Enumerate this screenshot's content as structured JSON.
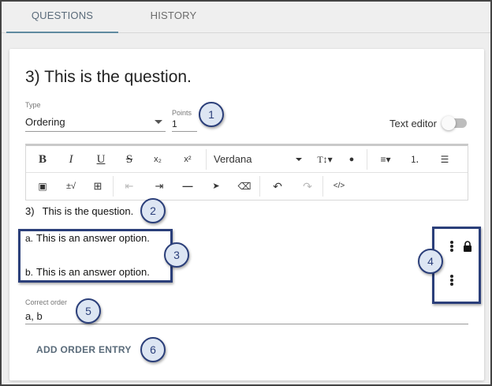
{
  "tabs": [
    {
      "label": "QUESTIONS",
      "active": true
    },
    {
      "label": "HISTORY",
      "active": false
    }
  ],
  "question": {
    "title": "3) This is the question.",
    "type_label": "Type",
    "type_value": "Ordering",
    "points_label": "Points",
    "points_value": "1",
    "text_editor_label": "Text editor",
    "text_editor_on": false
  },
  "toolbar": {
    "row1": [
      {
        "icon": "bold-icon",
        "glyph": "B"
      },
      {
        "icon": "italic-icon",
        "glyph": "I"
      },
      {
        "icon": "underline-icon",
        "glyph": "U"
      },
      {
        "icon": "strikethrough-icon",
        "glyph": "S"
      },
      {
        "icon": "subscript-icon",
        "glyph": "x₂"
      },
      {
        "icon": "superscript-icon",
        "glyph": "x²"
      },
      {
        "icon": "text-size-icon",
        "glyph": "T↕▾"
      },
      {
        "icon": "text-color-icon",
        "glyph": "●"
      },
      {
        "icon": "align-icon",
        "glyph": "≡▾"
      },
      {
        "icon": "ordered-list-icon",
        "glyph": "⒈"
      },
      {
        "icon": "bullet-list-icon",
        "glyph": "☰"
      }
    ],
    "font": "Verdana",
    "row2": [
      {
        "icon": "image-icon",
        "glyph": "▣"
      },
      {
        "icon": "math-icon",
        "glyph": "±√"
      },
      {
        "icon": "table-icon",
        "glyph": "⊞"
      },
      {
        "icon": "outdent-icon",
        "glyph": "⇤",
        "dim": true
      },
      {
        "icon": "indent-icon",
        "glyph": "⇥"
      },
      {
        "icon": "horizontal-rule-icon",
        "glyph": "—"
      },
      {
        "icon": "pointer-icon",
        "glyph": "➤"
      },
      {
        "icon": "eraser-icon",
        "glyph": "⌫"
      },
      {
        "icon": "undo-icon",
        "glyph": "↶"
      },
      {
        "icon": "redo-icon",
        "glyph": "↷",
        "dim": true
      },
      {
        "icon": "code-icon",
        "glyph": "</>"
      }
    ]
  },
  "body": {
    "question_number": "3)",
    "question_text": "This is the question."
  },
  "answers": [
    {
      "letter": "a.",
      "text": "This is an answer option."
    },
    {
      "letter": "b.",
      "text": "This is an answer option."
    }
  ],
  "correct_order": {
    "label": "Correct order",
    "value": "a, b"
  },
  "add_order_label": "ADD ORDER ENTRY",
  "callouts": [
    "1",
    "2",
    "3",
    "4",
    "5",
    "6"
  ],
  "colors": {
    "accent": "#5f8aa0",
    "callout_border": "#2b3f7a",
    "callout_fill": "#dde6f3"
  }
}
